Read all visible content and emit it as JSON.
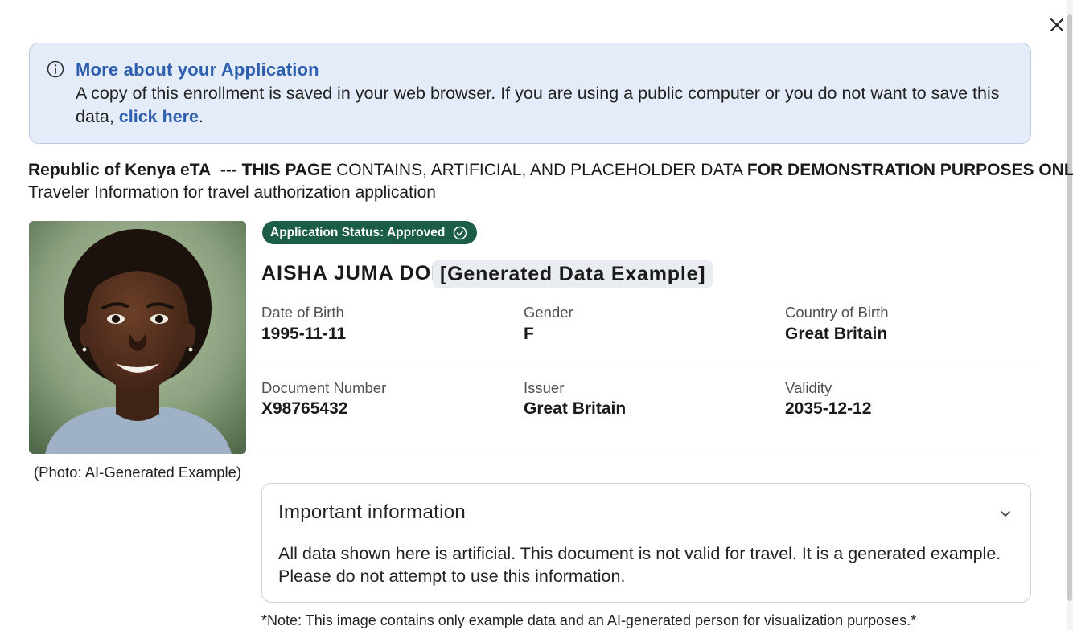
{
  "dialog": {
    "close_label": "Close"
  },
  "info_banner": {
    "title": "More about your Application",
    "text_before_link": "A copy of this enrollment is saved in your web browser. If you are using a public computer or you do not want to save this data, ",
    "link_text": "click here",
    "text_after_link": ".",
    "icon": "info-icon"
  },
  "header": {
    "country_app": "Republic of Kenya eTA",
    "sep_open": "--- ",
    "this_page": "THIS PAGE",
    "contains_text": "CONTAINS, ARTIFICIAL, AND PLACEHOLDER DATA",
    "demo_text": "FOR DEMONSTRATION PURPOSES ONLY ---",
    "subtitle": "Traveler Information for travel authorization application"
  },
  "photo": {
    "caption": "(Photo: AI-Generated Example)"
  },
  "status": {
    "label": "Application Status: Approved",
    "color": "#1b5e45",
    "icon": "check-circle-icon"
  },
  "traveler": {
    "name": "AISHA JUMA DOE",
    "tag": "[Generated Data Example]"
  },
  "fields": {
    "dob": {
      "label": "Date of Birth",
      "value": "1995-11-11"
    },
    "gender": {
      "label": "Gender",
      "value": "F"
    },
    "country_of_birth": {
      "label": "Country of Birth",
      "value": "Great Britain"
    },
    "document_number": {
      "label": "Document Number",
      "value": "X98765432"
    },
    "issuer": {
      "label": "Issuer",
      "value": "Great Britain"
    },
    "validity": {
      "label": "Validity",
      "value": "2035-12-12"
    }
  },
  "important": {
    "title": "Important information",
    "body": "All data shown here is artificial. This document is not valid for travel. It is a generated example. Please do not attempt to use this information.",
    "icon": "chevron-down-icon"
  },
  "footnote": "*Note: This image contains only example data and an AI-generated person for visualization purposes.*",
  "colors": {
    "accent_blue": "#2d5fae",
    "banner_bg": "#e5ecf9",
    "status_green": "#1b5e45"
  }
}
